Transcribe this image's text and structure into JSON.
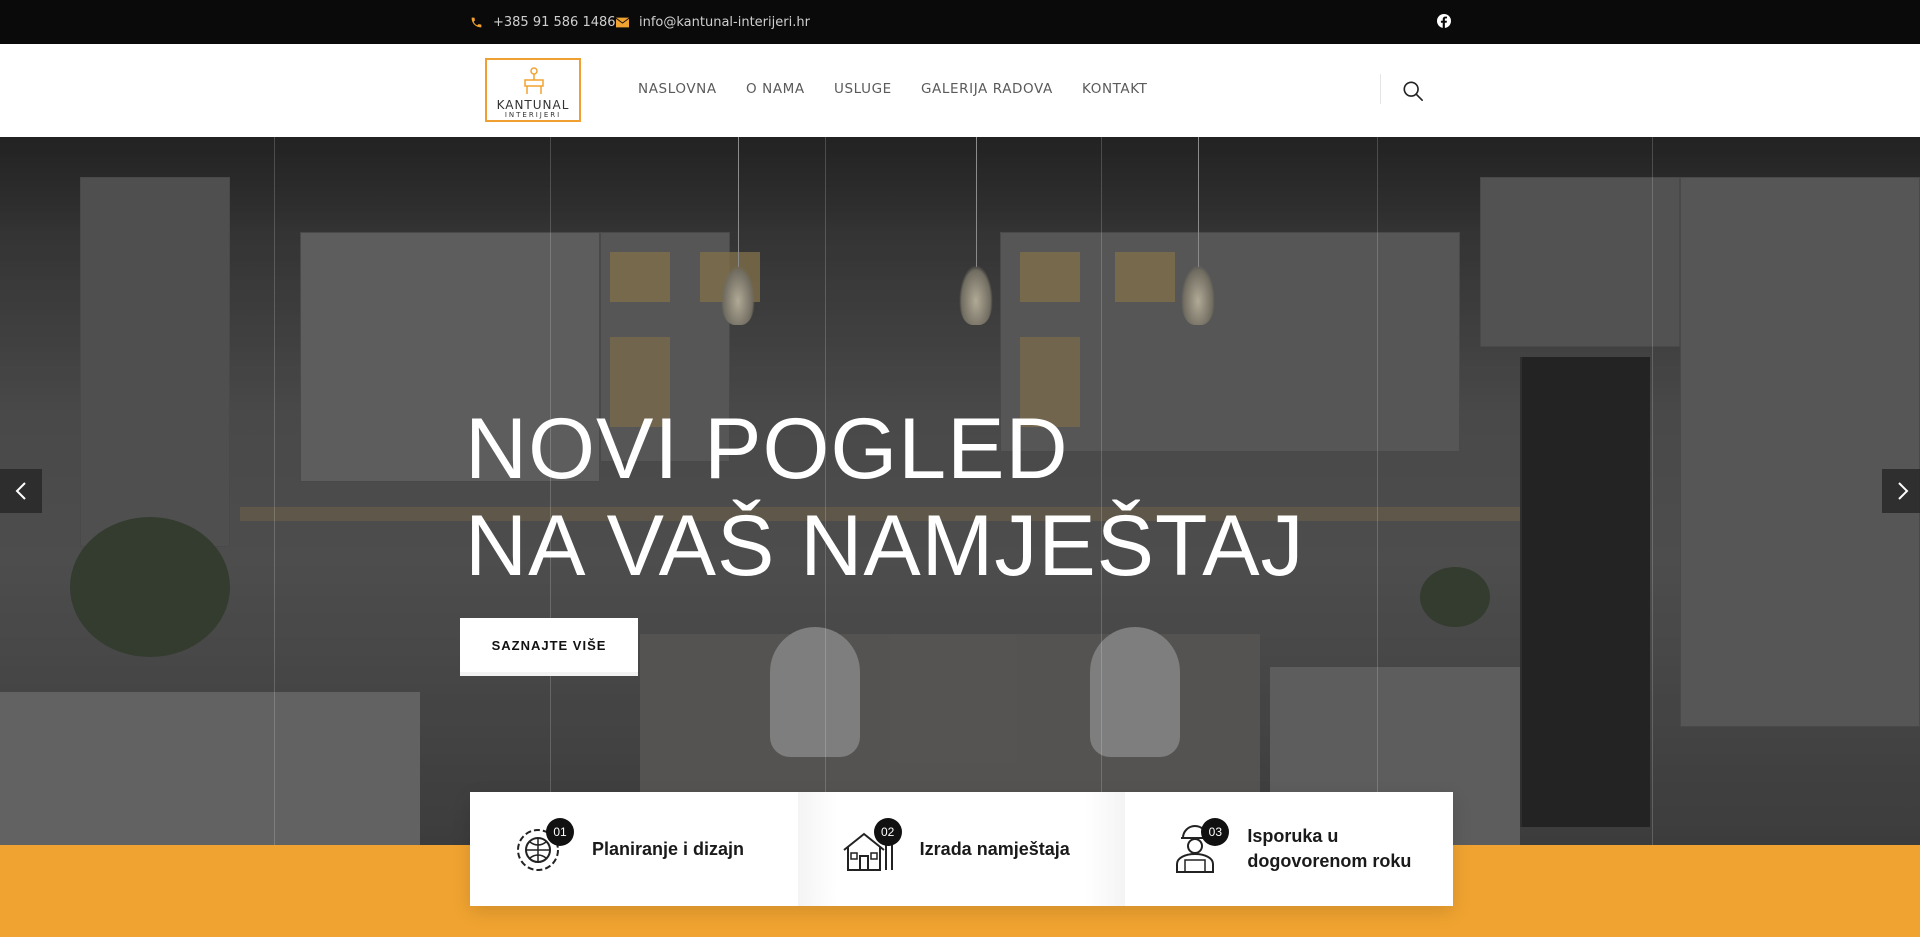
{
  "topbar": {
    "phone": "+385 91 586 1486",
    "email": "info@kantunal-interijeri.hr",
    "social_icon": "facebook-icon"
  },
  "header": {
    "logo": {
      "line1": "KANTUNAL",
      "line2": "INTERIJERI"
    },
    "nav": [
      "NASLOVNA",
      "O NAMA",
      "USLUGE",
      "GALERIJA RADOVA",
      "KONTAKT"
    ],
    "search_icon": "search-icon"
  },
  "hero": {
    "headline_line1": "NOVI POGLED",
    "headline_line2": "NA VAŠ NAMJEŠTAJ",
    "cta": "SAZNAJTE VIŠE"
  },
  "features": [
    {
      "number": "01",
      "title": "Planiranje i dizajn",
      "icon": "gear-globe-icon"
    },
    {
      "number": "02",
      "title": "Izrada namještaja",
      "icon": "house-tools-icon"
    },
    {
      "number": "03",
      "title": "Isporuka u dogovorenom roku",
      "icon": "worker-icon"
    }
  ],
  "colors": {
    "accent": "#f0a330",
    "topbar_bg": "#0a0a0a"
  }
}
